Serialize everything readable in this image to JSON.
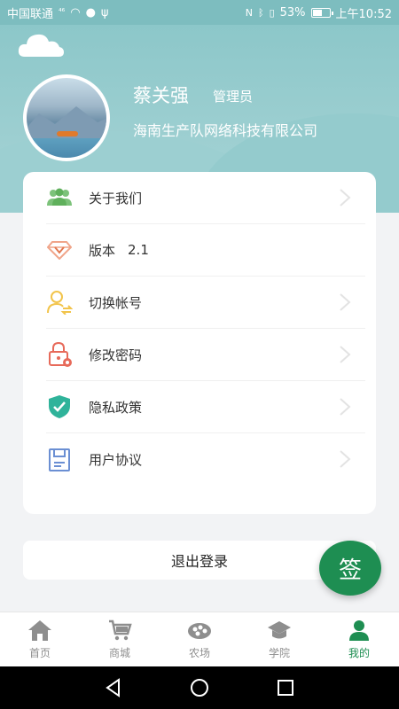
{
  "status_bar": {
    "carrier": "中国联通",
    "signal_label": "⁴⁶",
    "battery_percent": "53%",
    "battery_level": 0.53,
    "time": "上午10:52"
  },
  "profile": {
    "name": "蔡关强",
    "role": "管理员",
    "company": "海南生产队网络科技有限公司"
  },
  "menu": {
    "items": [
      {
        "label": "关于我们",
        "icon": "team-icon",
        "value": "",
        "has_arrow": true
      },
      {
        "label": "版本",
        "icon": "diamond-icon",
        "value": "2.1",
        "has_arrow": false
      },
      {
        "label": "切换帐号",
        "icon": "switch-user-icon",
        "value": "",
        "has_arrow": true
      },
      {
        "label": "修改密码",
        "icon": "lock-settings-icon",
        "value": "",
        "has_arrow": true
      },
      {
        "label": "隐私政策",
        "icon": "shield-check-icon",
        "value": "",
        "has_arrow": true
      },
      {
        "label": "用户协议",
        "icon": "agreement-icon",
        "value": "",
        "has_arrow": true
      }
    ]
  },
  "logout_label": "退出登录",
  "sign_button_label": "签",
  "tabs": [
    {
      "label": "首页",
      "icon": "home-icon",
      "active": false
    },
    {
      "label": "商城",
      "icon": "cart-icon",
      "active": false
    },
    {
      "label": "农场",
      "icon": "farm-icon",
      "active": false
    },
    {
      "label": "学院",
      "icon": "graduation-cap-icon",
      "active": false
    },
    {
      "label": "我的",
      "icon": "user-icon",
      "active": true
    }
  ],
  "colors": {
    "header": "#8cc7c9",
    "accent": "#1e8e52",
    "inactive_tab": "#8e8e8e"
  }
}
